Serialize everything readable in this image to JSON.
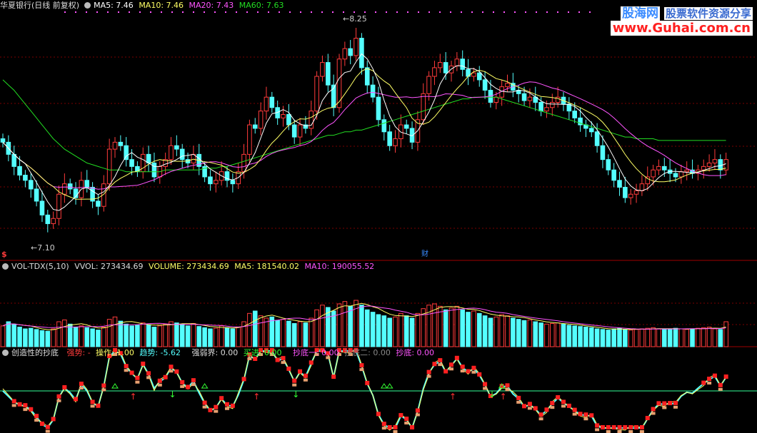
{
  "colors": {
    "up": "#ff3b3b",
    "down": "#54ffff",
    "ma5": "#ffffff",
    "ma10": "#ffff66",
    "ma20": "#ff55ff",
    "ma60": "#22dd22",
    "grid": "#7a0000"
  },
  "panel1": {
    "stock": "华夏银行(日线 前复权)",
    "ma5": "MA5: 7.46",
    "ma10": "MA10: 7.46",
    "ma20": "MA20: 7.43",
    "ma60": "MA60: 7.63",
    "high_label": "8.25",
    "low_label": "7.10",
    "marker_s": "$",
    "marker_cai": "财"
  },
  "panel2": {
    "name": "VOL-TDX(5,10)",
    "vvol": "VVOL: 273434.69",
    "volume": "VOLUME: 273434.69",
    "ma5": "MA5: 181540.02",
    "ma10": "MA10: 190055.52"
  },
  "panel3": {
    "name": "创造性的抄底",
    "qiangshi": "强势: -",
    "caozuo": "操作: 1.00",
    "qushi": "趋势: -5.62",
    "qiangruojie": "强弱界: 0.00",
    "maijin": "买进: 0.00",
    "chaodi1": "抄底一: 0.00",
    "chaodi2": "抄底二: 0.00",
    "chaodi": "抄底: 0.00"
  },
  "watermark": {
    "logo_a": "股海网",
    "logo_b": "股票软件资源分享",
    "url": "www.Guhai.com.cn"
  },
  "chart_data": [
    {
      "type": "candlestick",
      "title": "华夏银行(日线 前复权)",
      "series_names": [
        "MA5",
        "MA10",
        "MA20",
        "MA60"
      ],
      "ylim": [
        7.0,
        8.35
      ],
      "annotations": [
        {
          "label": "8.25",
          "value": 8.25
        },
        {
          "label": "7.10",
          "value": 7.1
        }
      ],
      "close": [
        7.62,
        7.55,
        7.48,
        7.43,
        7.4,
        7.35,
        7.28,
        7.2,
        7.15,
        7.18,
        7.32,
        7.38,
        7.35,
        7.3,
        7.4,
        7.36,
        7.28,
        7.25,
        7.38,
        7.58,
        7.62,
        7.6,
        7.52,
        7.48,
        7.45,
        7.55,
        7.5,
        7.42,
        7.48,
        7.52,
        7.6,
        7.58,
        7.52,
        7.5,
        7.55,
        7.48,
        7.42,
        7.38,
        7.4,
        7.45,
        7.4,
        7.38,
        7.45,
        7.55,
        7.72,
        7.7,
        7.8,
        7.88,
        7.82,
        7.76,
        7.78,
        7.72,
        7.65,
        7.72,
        7.7,
        7.8,
        8.0,
        8.08,
        7.95,
        7.82,
        8.1,
        8.16,
        8.12,
        8.22,
        8.05,
        7.95,
        7.88,
        7.75,
        7.68,
        7.6,
        7.64,
        7.72,
        7.7,
        7.62,
        7.75,
        7.9,
        8.0,
        8.05,
        8.08,
        8.02,
        8.06,
        8.1,
        8.04,
        8.0,
        8.02,
        7.98,
        7.92,
        7.85,
        7.88,
        7.94,
        7.96,
        7.92,
        7.9,
        7.86,
        7.88,
        7.85,
        7.8,
        7.82,
        7.85,
        7.88,
        7.84,
        7.8,
        7.76,
        7.72,
        7.7,
        7.68,
        7.6,
        7.52,
        7.46,
        7.4,
        7.36,
        7.3,
        7.32,
        7.34,
        7.38,
        7.42,
        7.46,
        7.48,
        7.46,
        7.44,
        7.42,
        7.45,
        7.46,
        7.44,
        7.46,
        7.48,
        7.5,
        7.52,
        7.46,
        7.52
      ],
      "ma60": [
        7.98,
        7.95,
        7.92,
        7.88,
        7.84,
        7.8,
        7.76,
        7.72,
        7.68,
        7.64,
        7.61,
        7.58,
        7.56,
        7.54,
        7.52,
        7.5,
        7.49,
        7.48,
        7.47,
        7.46,
        7.46,
        7.46,
        7.45,
        7.45,
        7.45,
        7.45,
        7.45,
        7.45,
        7.45,
        7.46,
        7.46,
        7.46,
        7.46,
        7.46,
        7.46,
        7.46,
        7.47,
        7.47,
        7.47,
        7.48,
        7.48,
        7.49,
        7.5,
        7.51,
        7.52,
        7.53,
        7.54,
        7.55,
        7.56,
        7.57,
        7.58,
        7.59,
        7.6,
        7.61,
        7.62,
        7.63,
        7.64,
        7.65,
        7.66,
        7.66,
        7.67,
        7.68,
        7.68,
        7.69,
        7.69,
        7.7,
        7.71,
        7.72,
        7.73,
        7.74,
        7.75,
        7.76,
        7.77,
        7.78,
        7.79,
        7.8,
        7.81,
        7.82,
        7.83,
        7.84,
        7.85,
        7.86,
        7.87,
        7.87,
        7.88,
        7.88,
        7.88,
        7.88,
        7.88,
        7.87,
        7.86,
        7.85,
        7.84,
        7.83,
        7.82,
        7.81,
        7.8,
        7.79,
        7.78,
        7.77,
        7.76,
        7.75,
        7.74,
        7.73,
        7.72,
        7.71,
        7.7,
        7.69,
        7.68,
        7.67,
        7.66,
        7.65,
        7.65,
        7.64,
        7.64,
        7.64,
        7.64,
        7.63,
        7.63,
        7.63,
        7.63,
        7.63,
        7.63,
        7.63,
        7.63,
        7.63,
        7.63,
        7.63,
        7.63,
        7.63
      ]
    },
    {
      "type": "bar",
      "title": "VOL-TDX(5,10)",
      "series_names": [
        "VOLUME",
        "MA5",
        "MA10"
      ],
      "ylim": [
        0,
        1200000
      ],
      "values": [
        350000,
        420000,
        380000,
        330000,
        300000,
        310000,
        290000,
        270000,
        260000,
        300000,
        420000,
        450000,
        380000,
        330000,
        350000,
        320000,
        300000,
        280000,
        330000,
        460000,
        500000,
        430000,
        380000,
        350000,
        360000,
        400000,
        370000,
        330000,
        350000,
        380000,
        420000,
        400000,
        380000,
        350000,
        390000,
        340000,
        320000,
        300000,
        310000,
        350000,
        320000,
        300000,
        330000,
        420000,
        560000,
        600000,
        520000,
        480000,
        500000,
        440000,
        460000,
        430000,
        390000,
        420000,
        400000,
        480000,
        620000,
        700000,
        660000,
        600000,
        720000,
        760000,
        680000,
        780000,
        700000,
        620000,
        580000,
        540000,
        520000,
        480000,
        500000,
        560000,
        520000,
        480000,
        560000,
        640000,
        700000,
        720000,
        680000,
        620000,
        650000,
        680000,
        620000,
        580000,
        600000,
        560000,
        520000,
        480000,
        500000,
        540000,
        520000,
        480000,
        460000,
        440000,
        450000,
        420000,
        400000,
        380000,
        390000,
        400000,
        380000,
        360000,
        350000,
        340000,
        330000,
        320000,
        300000,
        290000,
        280000,
        300000,
        310000,
        290000,
        280000,
        290000,
        300000,
        310000,
        320000,
        300000,
        290000,
        300000,
        310000,
        300000,
        290000,
        300000,
        310000,
        320000,
        330000,
        300000,
        290000,
        420000
      ]
    },
    {
      "type": "line",
      "title": "创造性的抄底",
      "series_names": [
        "强势",
        "操作",
        "趋势",
        "强弱界",
        "买进",
        "抄底一",
        "抄底二",
        "抄底"
      ]
    }
  ]
}
